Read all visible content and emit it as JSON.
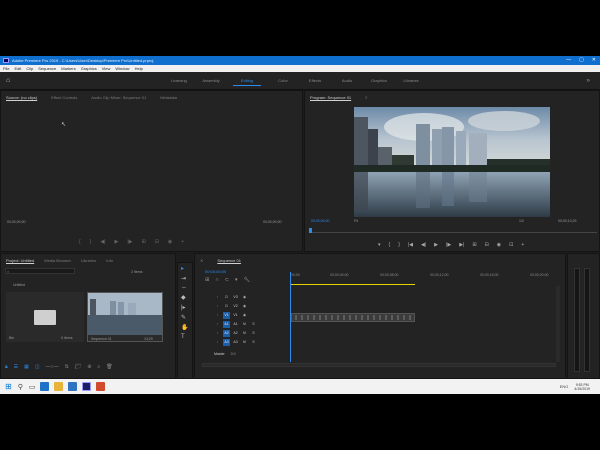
{
  "window": {
    "title": "Adobe Premiere Pro 2019 - C:\\Users\\User\\Desktop\\Premiere Pro\\Untitled.prproj",
    "controls": [
      "—",
      "▢",
      "✕"
    ]
  },
  "menu": [
    "File",
    "Edit",
    "Clip",
    "Sequence",
    "Markers",
    "Graphics",
    "View",
    "Window",
    "Help"
  ],
  "workspaces": [
    "Learning",
    "Assembly",
    "Editing",
    "Color",
    "Effects",
    "Audio",
    "Graphics",
    "Libraries"
  ],
  "workspace_more": "»",
  "source_panel": {
    "tabs": [
      "Source: (no clips)",
      "Effect Controls",
      "Audio Clip Mixer: Sequence 01",
      "Metadata"
    ],
    "timecode_in": "00;00;00;00",
    "timecode_out": "00;00;00;00"
  },
  "program_monitor": {
    "title": "Program: Sequence 01",
    "menu_icon": "≡",
    "timecode": "00;00;00;00",
    "fit": "Fit",
    "ratio": "1/2",
    "duration": "00;00;13;29",
    "transport": [
      "▾",
      "{",
      "}",
      "|◀",
      "◀|",
      "▶",
      "|▶",
      "▶|",
      "⊞",
      "⊟",
      "◉",
      "⊡",
      "+"
    ]
  },
  "project_panel": {
    "tabs": [
      "Project: Untitled",
      "Media Browser",
      "Libraries",
      "Info"
    ],
    "search_placeholder": "",
    "items_count": "2 Items",
    "bin_label": "Untitled",
    "bin_caption": "Bin",
    "bin_count": "0 Items",
    "clip_label": "Sequence 01",
    "clip_duration": "13;29"
  },
  "tools": [
    "▸",
    "⇥",
    "⇔",
    "◆",
    "|▸",
    "✎",
    "✋",
    "T"
  ],
  "timeline": {
    "tab": "Sequence 01",
    "timecode": "00;00;00;00",
    "ruler": [
      "00;00",
      "00;00;04;00",
      "00;00;08;00",
      "00;00;12;00",
      "00;00;16;00",
      "00;00;20;00"
    ],
    "tracks": [
      {
        "name": "V3"
      },
      {
        "name": "V2"
      },
      {
        "name": "V1"
      },
      {
        "name": "A1"
      },
      {
        "name": "A2"
      },
      {
        "name": "A3"
      }
    ],
    "master": "Master",
    "master_value": "0.0"
  },
  "taskbar": {
    "time": "9:53 PM",
    "date": "4/15/2019",
    "lang": "ENG"
  },
  "colors": {
    "accent": "#2d8ceb",
    "panel": "#232323",
    "titlebar": "#0f6fce"
  }
}
